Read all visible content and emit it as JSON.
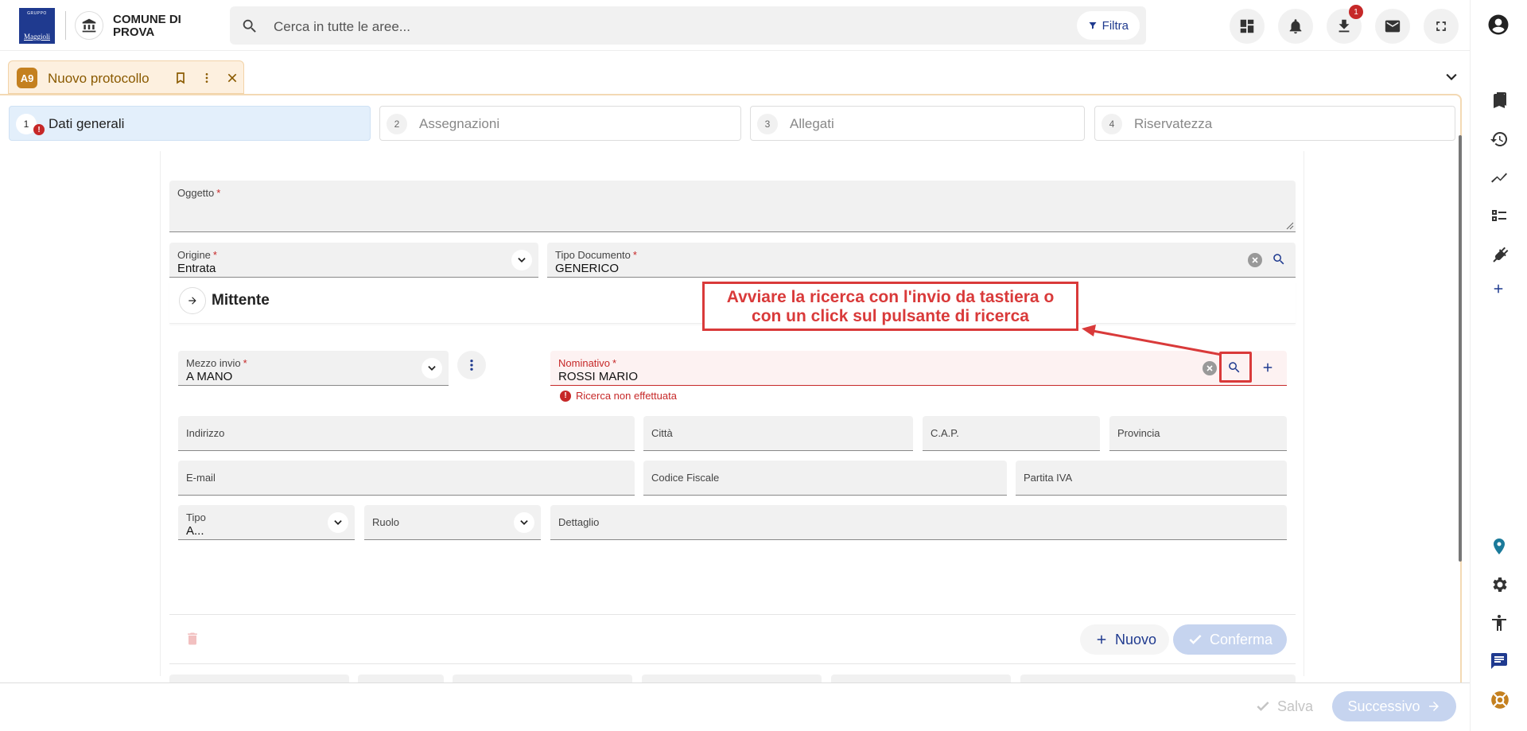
{
  "header": {
    "logo_small": "GRUPPO",
    "logo_brand": "Maggioli",
    "institution_name": "COMUNE DI PROVA",
    "search_placeholder": "Cerca in tutte le aree...",
    "filter_label": "Filtra",
    "download_badge": "1"
  },
  "tab": {
    "avatar": "A9",
    "title": "Nuovo protocollo"
  },
  "steps": [
    {
      "num": "1",
      "label": "Dati generali",
      "error": "!"
    },
    {
      "num": "2",
      "label": "Assegnazioni"
    },
    {
      "num": "3",
      "label": "Allegati"
    },
    {
      "num": "4",
      "label": "Riservatezza"
    }
  ],
  "form": {
    "oggetto": {
      "label": "Oggetto",
      "required": "*"
    },
    "origine": {
      "label": "Origine",
      "required": "*",
      "value": "Entrata"
    },
    "tipo_documento": {
      "label": "Tipo Documento",
      "required": "*",
      "value": "GENERICO"
    },
    "section_title": "Mittente",
    "mezzo_invio": {
      "label": "Mezzo invio",
      "required": "*",
      "value": "A MANO"
    },
    "nominativo": {
      "label": "Nominativo",
      "required": "*",
      "value": "ROSSI MARIO",
      "error": "Ricerca non effettuata"
    },
    "indirizzo": {
      "label": "Indirizzo"
    },
    "citta": {
      "label": "Città"
    },
    "cap": {
      "label": "C.A.P."
    },
    "provincia": {
      "label": "Provincia"
    },
    "email": {
      "label": "E-mail"
    },
    "codice_fiscale": {
      "label": "Codice Fiscale"
    },
    "partita_iva": {
      "label": "Partita IVA"
    },
    "tipo": {
      "label": "Tipo",
      "value": "A..."
    },
    "ruolo": {
      "label": "Ruolo"
    },
    "dettaglio": {
      "label": "Dettaglio"
    }
  },
  "callout": {
    "line1": "Avviare la ricerca con l'invio da tastiera o",
    "line2": "con un click sul pulsante di ricerca"
  },
  "actions": {
    "nuovo": "Nuovo",
    "conferma": "Conferma",
    "salva": "Salva",
    "successivo": "Successivo"
  },
  "colors": {
    "brand": "#1f3a8f",
    "accent_orange": "#c4801f",
    "error": "#c62828",
    "annotation": "#d93a3a"
  }
}
